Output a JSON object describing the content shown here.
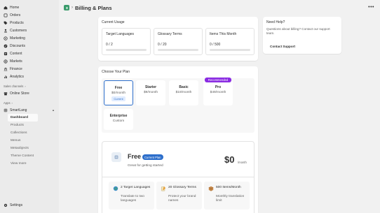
{
  "sidebar": {
    "nav": [
      {
        "label": "Home",
        "icon": "home-icon"
      },
      {
        "label": "Orders",
        "icon": "orders-icon"
      },
      {
        "label": "Products",
        "icon": "tag-icon"
      },
      {
        "label": "Customers",
        "icon": "person-icon"
      },
      {
        "label": "Marketing",
        "icon": "target-icon"
      },
      {
        "label": "Discounts",
        "icon": "discount-icon"
      },
      {
        "label": "Content",
        "icon": "content-icon"
      },
      {
        "label": "Markets",
        "icon": "globe-icon"
      },
      {
        "label": "Finance",
        "icon": "bank-icon"
      },
      {
        "label": "Analytics",
        "icon": "chart-icon"
      }
    ],
    "sales_channels_label": "Sales channels",
    "online_store": "Online Store",
    "apps_label": "Apps",
    "app_name": "SmartLang",
    "app_sub": [
      "Dashboard",
      "Products",
      "Collections",
      "Menus",
      "Metaobjects",
      "Theme Content",
      "View more"
    ],
    "settings": "Settings"
  },
  "header": {
    "title": "Billing & Plans",
    "more": "•••"
  },
  "usage": {
    "title": "Current Usage",
    "items": [
      {
        "label": "Target Languages",
        "value": "0 / 2",
        "fraction": 0
      },
      {
        "label": "Glossary Terms",
        "value": "0 / 20",
        "fraction": 0
      },
      {
        "label": "Items This Month",
        "value": "0 / 500",
        "fraction": 0
      }
    ]
  },
  "help": {
    "title": "Need Help?",
    "text": "Questions about billing? Contact our support team.",
    "button": "Contact Support"
  },
  "plans": {
    "title": "Choose Your Plan",
    "items": [
      {
        "name": "Free",
        "price": "$0/month",
        "badge": "Current"
      },
      {
        "name": "Starter",
        "price": "$9/month"
      },
      {
        "name": "Basic",
        "price": "$19/month"
      },
      {
        "name": "Pro",
        "price": "$49/month",
        "badge": "Recommended"
      },
      {
        "name": "Enterprise",
        "price": "Custom"
      }
    ]
  },
  "free_detail": {
    "name": "Free",
    "badge": "Current Plan",
    "tagline": "Great for getting started",
    "price": "$0",
    "per": "/month",
    "features": [
      {
        "title": "2 Target Languages",
        "desc": "Translate to two languages",
        "icon": "globe-icon"
      },
      {
        "title": "20 Glossary Terms",
        "desc": "Protect your brand names",
        "icon": "notepad-icon"
      },
      {
        "title": "500 Items/Month",
        "desc": "Monthly translation limit",
        "icon": "box-icon"
      }
    ]
  },
  "colors": {
    "accent": "#2c6ecb",
    "success": "#3a9b6b",
    "recommended": "#8a2be2"
  }
}
